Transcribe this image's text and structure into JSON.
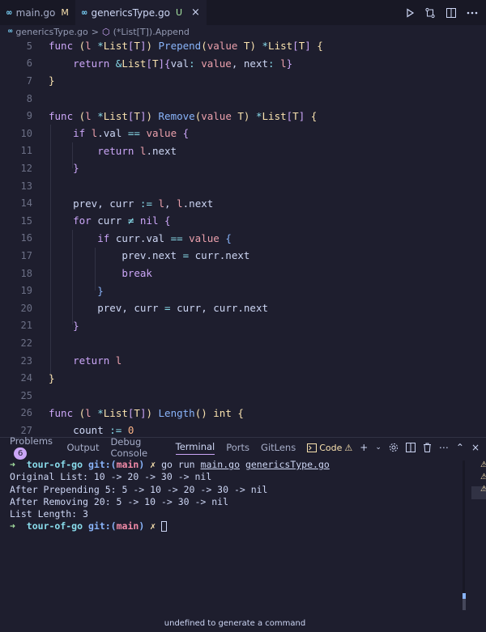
{
  "tabs": [
    {
      "icon": "go-icon",
      "icon_text": "∞",
      "label": "main.go",
      "status": "M",
      "active": false
    },
    {
      "icon": "go-icon",
      "icon_text": "∞",
      "label": "genericsType.go",
      "status": "U",
      "active": true,
      "close": "×"
    }
  ],
  "tab_actions": [
    "run-icon",
    "compare-icon",
    "split-editor-icon",
    "more-icon"
  ],
  "breadcrumb": {
    "file": "genericsType.go",
    "separator": ">",
    "symbol": "(*List[T]).Append"
  },
  "editor": {
    "line_numbers": [
      "5",
      "6",
      "7",
      "8",
      "9",
      "10",
      "11",
      "12",
      "13",
      "14",
      "15",
      "16",
      "17",
      "18",
      "19",
      "20",
      "21",
      "22",
      "23",
      "24",
      "25",
      "26",
      "27"
    ]
  },
  "panel": {
    "tabs": [
      "Problems",
      "Output",
      "Debug Console",
      "Terminal",
      "Ports",
      "GitLens"
    ],
    "problems_count": "6",
    "active_tab": "Terminal",
    "terminal_name": "Code",
    "terminal": {
      "prompt_arrow": "➜",
      "dir": "tour-of-go",
      "git_label": "git:(",
      "branch": "main",
      "git_close": ")",
      "dirty": "✗",
      "command_prefix": "go run ",
      "command_file1": "main.go",
      "command_sep": " ",
      "command_file2": "genericsType.go",
      "output": [
        "Original List: 10 -> 20 -> 30 -> nil",
        "After Prepending 5: 5 -> 10 -> 20 -> 30 -> nil",
        "After Removing 20: 5 -> 10 -> 30 -> nil",
        "List Length: 3"
      ]
    },
    "hint": "undefined to generate a command"
  },
  "colors": {
    "background": "#1e1e2e",
    "keyword": "#cba6f7",
    "function": "#89b4fa",
    "type": "#f9e2af",
    "param": "#eba0ac",
    "number": "#fab387"
  }
}
